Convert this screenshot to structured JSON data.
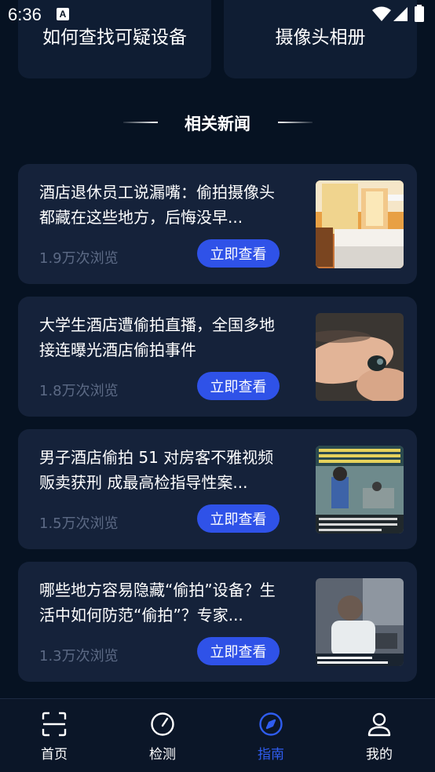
{
  "status_bar": {
    "time": "6:36",
    "a_icon": "A"
  },
  "top_cards": [
    {
      "label": "如何查找可疑设备"
    },
    {
      "label": "摄像头相册"
    }
  ],
  "section": {
    "title": "相关新闻"
  },
  "news": [
    {
      "title": "酒店退休员工说漏嘴：偷拍摄像头都藏在这些地方，后悔没早...",
      "views": "1.9万次浏览",
      "button": "立即查看",
      "thumb": "hotel-room-image"
    },
    {
      "title": "大学生酒店遭偷拍直播，全国多地接连曝光酒店偷拍事件",
      "views": "1.8万次浏览",
      "button": "立即查看",
      "thumb": "hidden-camera-in-fingers-image"
    },
    {
      "title": "男子酒店偷拍 51 对房客不雅视频贩卖获刑 成最高检指导性案...",
      "views": "1.5万次浏览",
      "button": "立即查看",
      "thumb": "interrogation-room-image"
    },
    {
      "title": "哪些地方容易隐藏“偷拍”设备？生活中如何防范“偷拍”？专家...",
      "views": "1.3万次浏览",
      "button": "立即查看",
      "thumb": "news-interview-image"
    }
  ],
  "nav": [
    {
      "label": "首页",
      "icon": "scan-icon",
      "active": false
    },
    {
      "label": "检测",
      "icon": "gauge-icon",
      "active": false
    },
    {
      "label": "指南",
      "icon": "compass-icon",
      "active": true
    },
    {
      "label": "我的",
      "icon": "user-icon",
      "active": false
    }
  ],
  "colors": {
    "background": "#061222",
    "card": "#15223a",
    "accent": "#2f52e8",
    "active_nav": "#2f5df0",
    "muted_text": "#5c6a85"
  }
}
